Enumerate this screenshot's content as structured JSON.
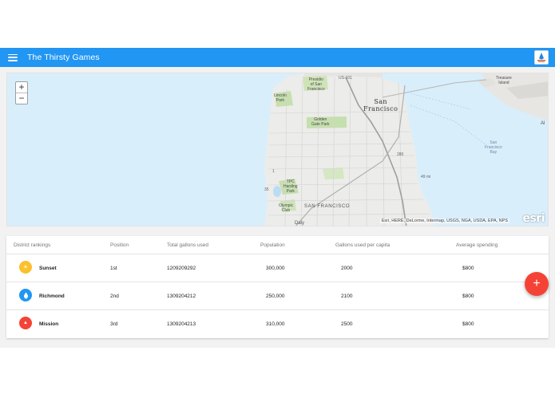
{
  "app": {
    "title": "The Thirsty Games",
    "menu_icon": "hamburger-menu-icon",
    "logo": "app-logo",
    "accent_color": "#2196f3"
  },
  "map": {
    "zoom_in_label": "+",
    "zoom_out_label": "−",
    "attribution": "Esri, HERE, DeLorme, Intermap, USGS, NGA, USDA, EPA, NPS",
    "esri_logo": "esri",
    "labels": {
      "city": "San\nFrancisco",
      "city_bottom": "SAN FRANCISCO",
      "golden_gate_park": "Golden\nGate Park",
      "lincoln_park": "Lincoln\nPark",
      "presidio": "Presidio\nof San\nFrancisco",
      "tpc_harding": "TPC\nHarding\nPark",
      "olympic_club": "Olympic\nClub",
      "daly": "Daly",
      "treasure_island": "Treasure\nIsland",
      "sf_bay": "San\nFrancisco\nBay",
      "route_101": "US-101",
      "route_280": "280",
      "route_49": "49 mi",
      "route_35": "35",
      "route_1": "1",
      "al": "Al"
    },
    "land_color": "#ececea",
    "water_color": "#d9eefb",
    "park_color": "#c6dfae"
  },
  "table": {
    "headers": {
      "district": "District rankings",
      "position": "Position",
      "gallons": "Total gallons used",
      "population": "Population",
      "per_capita": "Gallons used per capita",
      "spending": "Average spending"
    },
    "rows": [
      {
        "name": "Sunset",
        "position": "1st",
        "gallons": "1209209292",
        "population": "300,000",
        "per_capita": "2000",
        "spending": "$800",
        "icon": "sun-icon",
        "icon_glyph": "☀",
        "color": "#fbc02d"
      },
      {
        "name": "Richmond",
        "position": "2nd",
        "gallons": "1309204212",
        "population": "250,000",
        "per_capita": "2100",
        "spending": "$800",
        "icon": "water-drop-icon",
        "icon_glyph": "●",
        "color": "#2196f3"
      },
      {
        "name": "Mission",
        "position": "3rd",
        "gallons": "1309204213",
        "population": "310,000",
        "per_capita": "2500",
        "spending": "$800",
        "icon": "triangle-icon",
        "icon_glyph": "▲",
        "color": "#f44336"
      }
    ]
  },
  "fab": {
    "label": "+",
    "icon": "add-icon",
    "color": "#f44336"
  }
}
